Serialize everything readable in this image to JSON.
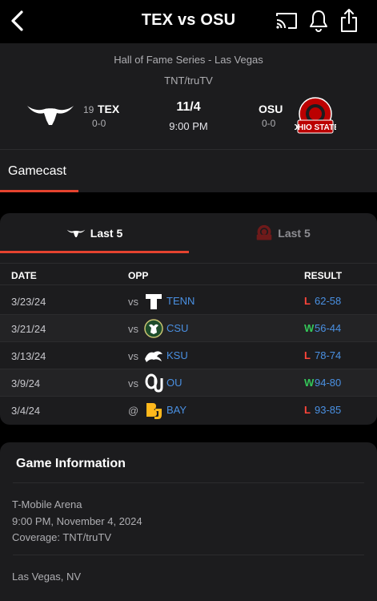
{
  "nav": {
    "title": "TEX vs OSU",
    "back_icon": "chevron-left-icon",
    "cast_icon": "cast-icon",
    "alert_icon": "bell-icon",
    "share_icon": "share-icon"
  },
  "game": {
    "series": "Hall of Fame Series - Las Vegas",
    "network": "TNT/truTV",
    "date": "11/4",
    "time": "9:00 PM",
    "away": {
      "rank": "19",
      "abbr": "TEX",
      "record": "0-0",
      "logo": "longhorn-logo",
      "color": "#ffffff"
    },
    "home": {
      "abbr": "OSU",
      "record": "0-0",
      "logo": "ohio-state-logo",
      "color": "#bb0000"
    }
  },
  "tabs": [
    {
      "label": "Gamecast",
      "active": true
    }
  ],
  "last5": {
    "tabs": [
      {
        "label": "Last 5",
        "team": "TEX",
        "active": true
      },
      {
        "label": "Last 5",
        "team": "OSU",
        "active": false
      }
    ],
    "columns": {
      "date": "DATE",
      "opp": "OPP",
      "result": "RESULT"
    },
    "rows": [
      {
        "date": "3/23/24",
        "prefix": "vs",
        "opp": "TENN",
        "wl": "L",
        "score": "62-58",
        "logo": "tennessee-logo"
      },
      {
        "date": "3/21/24",
        "prefix": "vs",
        "opp": "CSU",
        "wl": "W",
        "score": "56-44",
        "logo": "colorado-state-logo"
      },
      {
        "date": "3/13/24",
        "prefix": "vs",
        "opp": "KSU",
        "wl": "L",
        "score": "78-74",
        "logo": "kansas-state-logo"
      },
      {
        "date": "3/9/24",
        "prefix": "vs",
        "opp": "OU",
        "wl": "W",
        "score": "94-80",
        "logo": "oklahoma-logo"
      },
      {
        "date": "3/4/24",
        "prefix": "@",
        "opp": "BAY",
        "wl": "L",
        "score": "93-85",
        "logo": "baylor-logo"
      }
    ]
  },
  "game_info": {
    "title": "Game Information",
    "venue": "T-Mobile Arena",
    "datetime": "9:00 PM, November 4, 2024",
    "coverage": "Coverage: TNT/truTV",
    "location": "Las Vegas, NV"
  },
  "colors": {
    "accent": "#e5432f",
    "win": "#34c759",
    "loss": "#ff453a",
    "link": "#4a90e2",
    "card": "#1c1c1e"
  }
}
